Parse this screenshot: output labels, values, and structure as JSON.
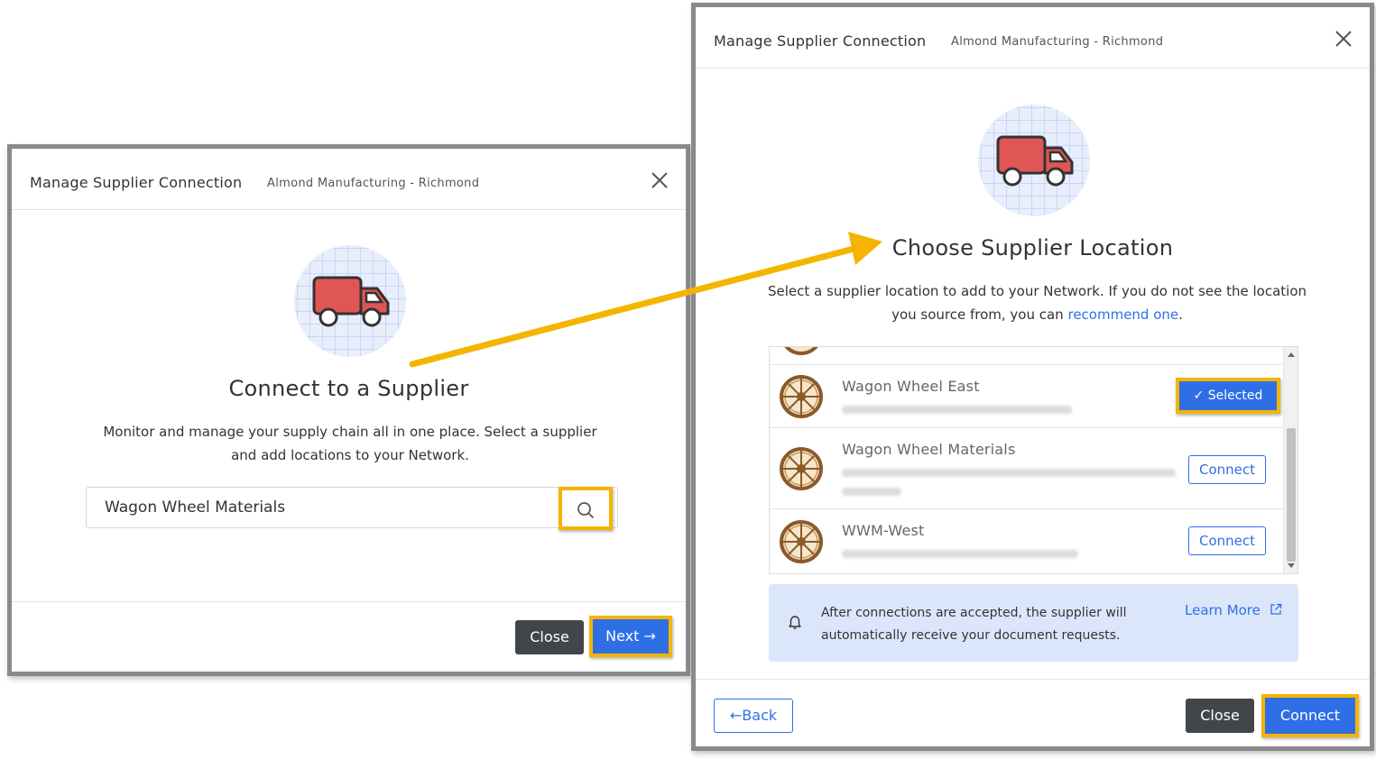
{
  "modal1": {
    "title": "Manage Supplier Connection",
    "subtitle": "Almond Manufacturing - Richmond",
    "heading": "Connect to a Supplier",
    "description": "Monitor and manage your supply chain all in one place. Select a supplier and add locations to your Network.",
    "search": {
      "value": "Wagon Wheel Materials"
    },
    "close_label": "Close",
    "next_label": "Next"
  },
  "modal2": {
    "title": "Manage Supplier Connection",
    "subtitle": "Almond Manufacturing - Richmond",
    "heading": "Choose Supplier Location",
    "description_1": "Select a supplier location to add to your Network. If you do not see the location you source from, you can",
    "description_link": "recommend one",
    "description_end": ".",
    "locations": [
      {
        "name": "Wagon Wheel East",
        "action": "Selected"
      },
      {
        "name": "Wagon Wheel Materials",
        "action": "Connect"
      },
      {
        "name": "WWM-West",
        "action": "Connect"
      }
    ],
    "info_text": "After connections are accepted, the supplier will automatically receive your document requests.",
    "learn_more": "Learn More",
    "back_label": "Back",
    "close_label": "Close",
    "connect_label": "Connect"
  },
  "colors": {
    "primary": "#2f6fe6",
    "highlight": "#f4b400",
    "dark_button": "#42464b",
    "truck": "#e05555"
  }
}
